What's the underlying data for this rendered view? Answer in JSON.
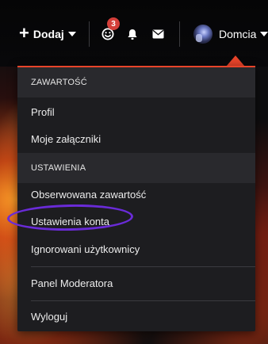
{
  "navbar": {
    "add_label": "Dodaj",
    "smiley_badge": "3",
    "user_name": "Domcia"
  },
  "icons": {
    "add": "plus-icon",
    "add_caret": "caret-down-icon",
    "emoji": "smiley-icon",
    "notifications": "bell-icon",
    "messages": "envelope-icon",
    "user_caret": "caret-down-icon"
  },
  "colors": {
    "accent": "#e8442a",
    "badge": "#d43f3a",
    "highlight_ring": "#6a2bd8",
    "menu_bg": "#1d1d20",
    "section_bg": "#29292d"
  },
  "dropdown": {
    "section_content": "ZAWARTOŚĆ",
    "profile": "Profil",
    "attachments": "Moje załączniki",
    "section_settings": "USTAWIENIA",
    "watched": "Obserwowana zawartość",
    "account_settings": "Ustawienia konta",
    "ignored_users": "Ignorowani użytkownicy",
    "moderator_panel": "Panel Moderatora",
    "logout": "Wyloguj"
  }
}
